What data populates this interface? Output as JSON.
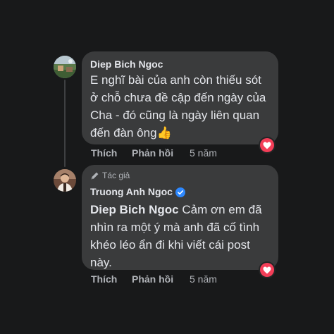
{
  "comments": [
    {
      "author": "Diep Bich Ngoc",
      "text": "E nghĩ bài của anh còn thiếu sót ở chỗ chưa đề cập đến ngày của Cha - đó cũng là ngày liên quan đến đàn ông",
      "emoji": "👍",
      "like_label": "Thích",
      "reply_label": "Phản hồi",
      "time": "5 năm",
      "reaction": "love"
    },
    {
      "badge_label": "Tác giả",
      "author": "Truong Anh Ngoc",
      "verified": true,
      "mention": "Diep Bich Ngoc",
      "text": " Cảm ơn em đã nhìn ra một ý mà anh đã cố tình khéo léo ẩn đi khi viết cái post này.",
      "like_label": "Thích",
      "reply_label": "Phản hồi",
      "time": "5 năm",
      "reaction": "love"
    }
  ],
  "colors": {
    "background": "#18191a",
    "bubble": "#3a3b3c",
    "text": "#e4e6eb",
    "secondary_text": "#b0b3b8",
    "love_reaction": "#f33e58",
    "verified": "#2d88ff"
  }
}
